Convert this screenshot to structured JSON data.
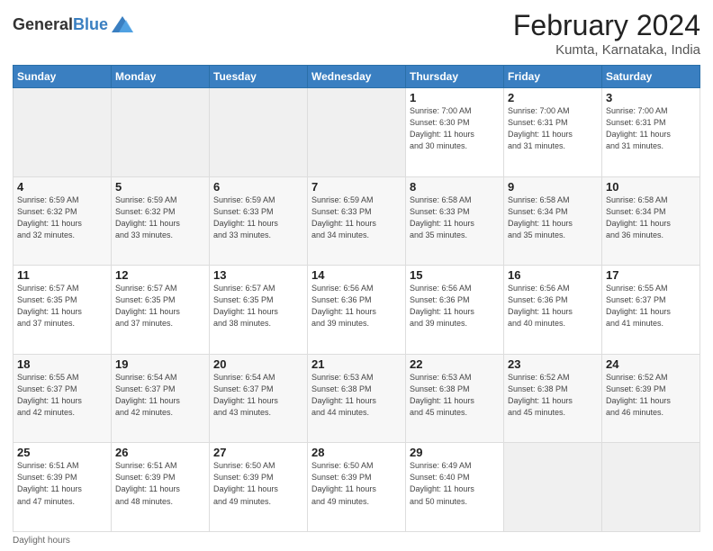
{
  "header": {
    "logo_general": "General",
    "logo_blue": "Blue",
    "title": "February 2024",
    "subtitle": "Kumta, Karnataka, India"
  },
  "footer": {
    "note": "Daylight hours"
  },
  "columns": [
    "Sunday",
    "Monday",
    "Tuesday",
    "Wednesday",
    "Thursday",
    "Friday",
    "Saturday"
  ],
  "weeks": [
    [
      {
        "day": "",
        "info": ""
      },
      {
        "day": "",
        "info": ""
      },
      {
        "day": "",
        "info": ""
      },
      {
        "day": "",
        "info": ""
      },
      {
        "day": "1",
        "info": "Sunrise: 7:00 AM\nSunset: 6:30 PM\nDaylight: 11 hours\nand 30 minutes."
      },
      {
        "day": "2",
        "info": "Sunrise: 7:00 AM\nSunset: 6:31 PM\nDaylight: 11 hours\nand 31 minutes."
      },
      {
        "day": "3",
        "info": "Sunrise: 7:00 AM\nSunset: 6:31 PM\nDaylight: 11 hours\nand 31 minutes."
      }
    ],
    [
      {
        "day": "4",
        "info": "Sunrise: 6:59 AM\nSunset: 6:32 PM\nDaylight: 11 hours\nand 32 minutes."
      },
      {
        "day": "5",
        "info": "Sunrise: 6:59 AM\nSunset: 6:32 PM\nDaylight: 11 hours\nand 33 minutes."
      },
      {
        "day": "6",
        "info": "Sunrise: 6:59 AM\nSunset: 6:33 PM\nDaylight: 11 hours\nand 33 minutes."
      },
      {
        "day": "7",
        "info": "Sunrise: 6:59 AM\nSunset: 6:33 PM\nDaylight: 11 hours\nand 34 minutes."
      },
      {
        "day": "8",
        "info": "Sunrise: 6:58 AM\nSunset: 6:33 PM\nDaylight: 11 hours\nand 35 minutes."
      },
      {
        "day": "9",
        "info": "Sunrise: 6:58 AM\nSunset: 6:34 PM\nDaylight: 11 hours\nand 35 minutes."
      },
      {
        "day": "10",
        "info": "Sunrise: 6:58 AM\nSunset: 6:34 PM\nDaylight: 11 hours\nand 36 minutes."
      }
    ],
    [
      {
        "day": "11",
        "info": "Sunrise: 6:57 AM\nSunset: 6:35 PM\nDaylight: 11 hours\nand 37 minutes."
      },
      {
        "day": "12",
        "info": "Sunrise: 6:57 AM\nSunset: 6:35 PM\nDaylight: 11 hours\nand 37 minutes."
      },
      {
        "day": "13",
        "info": "Sunrise: 6:57 AM\nSunset: 6:35 PM\nDaylight: 11 hours\nand 38 minutes."
      },
      {
        "day": "14",
        "info": "Sunrise: 6:56 AM\nSunset: 6:36 PM\nDaylight: 11 hours\nand 39 minutes."
      },
      {
        "day": "15",
        "info": "Sunrise: 6:56 AM\nSunset: 6:36 PM\nDaylight: 11 hours\nand 39 minutes."
      },
      {
        "day": "16",
        "info": "Sunrise: 6:56 AM\nSunset: 6:36 PM\nDaylight: 11 hours\nand 40 minutes."
      },
      {
        "day": "17",
        "info": "Sunrise: 6:55 AM\nSunset: 6:37 PM\nDaylight: 11 hours\nand 41 minutes."
      }
    ],
    [
      {
        "day": "18",
        "info": "Sunrise: 6:55 AM\nSunset: 6:37 PM\nDaylight: 11 hours\nand 42 minutes."
      },
      {
        "day": "19",
        "info": "Sunrise: 6:54 AM\nSunset: 6:37 PM\nDaylight: 11 hours\nand 42 minutes."
      },
      {
        "day": "20",
        "info": "Sunrise: 6:54 AM\nSunset: 6:37 PM\nDaylight: 11 hours\nand 43 minutes."
      },
      {
        "day": "21",
        "info": "Sunrise: 6:53 AM\nSunset: 6:38 PM\nDaylight: 11 hours\nand 44 minutes."
      },
      {
        "day": "22",
        "info": "Sunrise: 6:53 AM\nSunset: 6:38 PM\nDaylight: 11 hours\nand 45 minutes."
      },
      {
        "day": "23",
        "info": "Sunrise: 6:52 AM\nSunset: 6:38 PM\nDaylight: 11 hours\nand 45 minutes."
      },
      {
        "day": "24",
        "info": "Sunrise: 6:52 AM\nSunset: 6:39 PM\nDaylight: 11 hours\nand 46 minutes."
      }
    ],
    [
      {
        "day": "25",
        "info": "Sunrise: 6:51 AM\nSunset: 6:39 PM\nDaylight: 11 hours\nand 47 minutes."
      },
      {
        "day": "26",
        "info": "Sunrise: 6:51 AM\nSunset: 6:39 PM\nDaylight: 11 hours\nand 48 minutes."
      },
      {
        "day": "27",
        "info": "Sunrise: 6:50 AM\nSunset: 6:39 PM\nDaylight: 11 hours\nand 49 minutes."
      },
      {
        "day": "28",
        "info": "Sunrise: 6:50 AM\nSunset: 6:39 PM\nDaylight: 11 hours\nand 49 minutes."
      },
      {
        "day": "29",
        "info": "Sunrise: 6:49 AM\nSunset: 6:40 PM\nDaylight: 11 hours\nand 50 minutes."
      },
      {
        "day": "",
        "info": ""
      },
      {
        "day": "",
        "info": ""
      }
    ]
  ]
}
